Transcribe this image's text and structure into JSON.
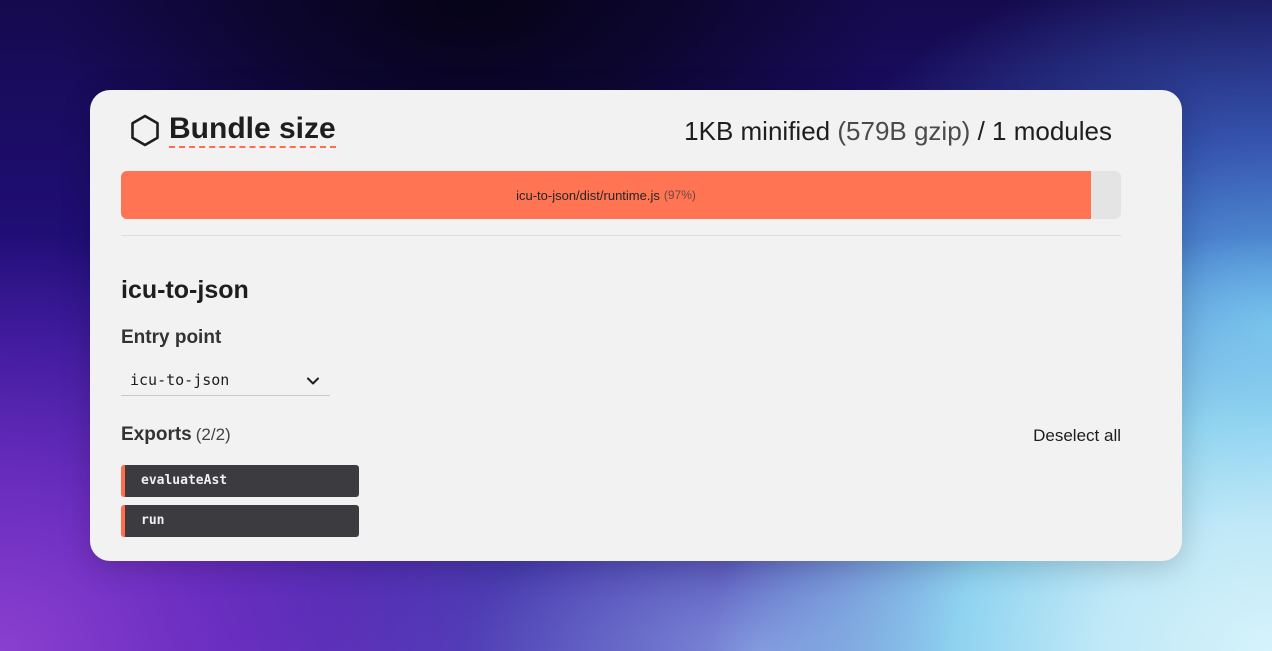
{
  "header": {
    "title": "Bundle size",
    "minified": "1KB minified",
    "gzip": "(579B gzip)",
    "separator": "/",
    "modules": "1 modules"
  },
  "bar": {
    "file": "icu-to-json/dist/runtime.js",
    "percent_label": "(97%)",
    "percent": 97,
    "fill_color": "#ff7452"
  },
  "package": {
    "name": "icu-to-json"
  },
  "entry": {
    "label": "Entry point",
    "selected": "icu-to-json"
  },
  "exports": {
    "label": "Exports",
    "count": "(2/2)",
    "deselect_label": "Deselect all",
    "items": [
      {
        "name": "evaluateAst"
      },
      {
        "name": "run"
      }
    ]
  },
  "colors": {
    "accent": "#ff6d4d",
    "card": "#f2f2f2",
    "export_bg": "#3c3c40"
  },
  "icons": {
    "logo": "hexagon-icon",
    "dropdown": "chevron-down-icon"
  }
}
